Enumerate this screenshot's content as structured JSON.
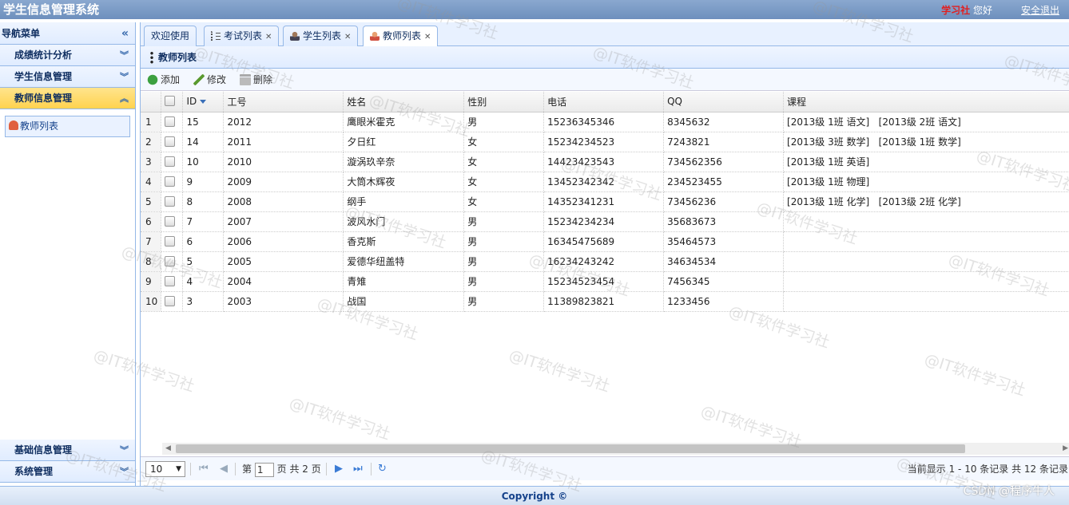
{
  "app_title": "学生信息管理系统",
  "header": {
    "brand": "学习社",
    "greeting": " 您好",
    "logout": "安全退出"
  },
  "sidebar": {
    "title": "导航菜单",
    "groups": [
      "成绩统计分析",
      "学生信息管理",
      "教师信息管理"
    ],
    "sub_items": [
      "教师列表"
    ],
    "bottom_groups": [
      "基础信息管理",
      "系统管理"
    ]
  },
  "tabs": [
    {
      "label": "欢迎使用"
    },
    {
      "label": "考试列表"
    },
    {
      "label": "学生列表"
    },
    {
      "label": "教师列表"
    }
  ],
  "panel_title": "教师列表",
  "toolbar": {
    "add": "添加",
    "edit": "修改",
    "delete": "删除"
  },
  "columns": [
    "ID",
    "工号",
    "姓名",
    "性别",
    "电话",
    "QQ",
    "课程"
  ],
  "rows": [
    [
      "1",
      "15",
      "2012",
      "鹰眼米霍克",
      "男",
      "15236345346",
      "8345632",
      "[2013级 1班 语文]   [2013级 2班 语文]"
    ],
    [
      "2",
      "14",
      "2011",
      "夕日红",
      "女",
      "15234234523",
      "7243821",
      "[2013级 3班 数学]   [2013级 1班 数学]"
    ],
    [
      "3",
      "10",
      "2010",
      "漩涡玖辛奈",
      "女",
      "14423423543",
      "734562356",
      "[2013级 1班 英语]"
    ],
    [
      "4",
      "9",
      "2009",
      "大筒木辉夜",
      "女",
      "13452342342",
      "234523455",
      "[2013级 1班 物理]"
    ],
    [
      "5",
      "8",
      "2008",
      "纲手",
      "女",
      "14352341231",
      "73456236",
      "[2013级 1班 化学]   [2013级 2班 化学]"
    ],
    [
      "6",
      "7",
      "2007",
      "波风水门",
      "男",
      "15234234234",
      "35683673",
      ""
    ],
    [
      "7",
      "6",
      "2006",
      "香克斯",
      "男",
      "16345475689",
      "35464573",
      ""
    ],
    [
      "8",
      "5",
      "2005",
      "爱德华纽盖特",
      "男",
      "16234243242",
      "34634534",
      ""
    ],
    [
      "9",
      "4",
      "2004",
      "青雉",
      "男",
      "15234523454",
      "7456345",
      ""
    ],
    [
      "10",
      "3",
      "2003",
      "战国",
      "男",
      "11389823821",
      "1233456",
      ""
    ]
  ],
  "pager": {
    "page_size": "10",
    "page_label": "第",
    "page_value": "1",
    "total_label": "页 共 2 页",
    "info": "当前显示 1 - 10 条记录 共 12 条记录"
  },
  "footer": "Copyright ©",
  "csdn": "CSDN @程序牛人",
  "watermark": "@IT软件学习社"
}
